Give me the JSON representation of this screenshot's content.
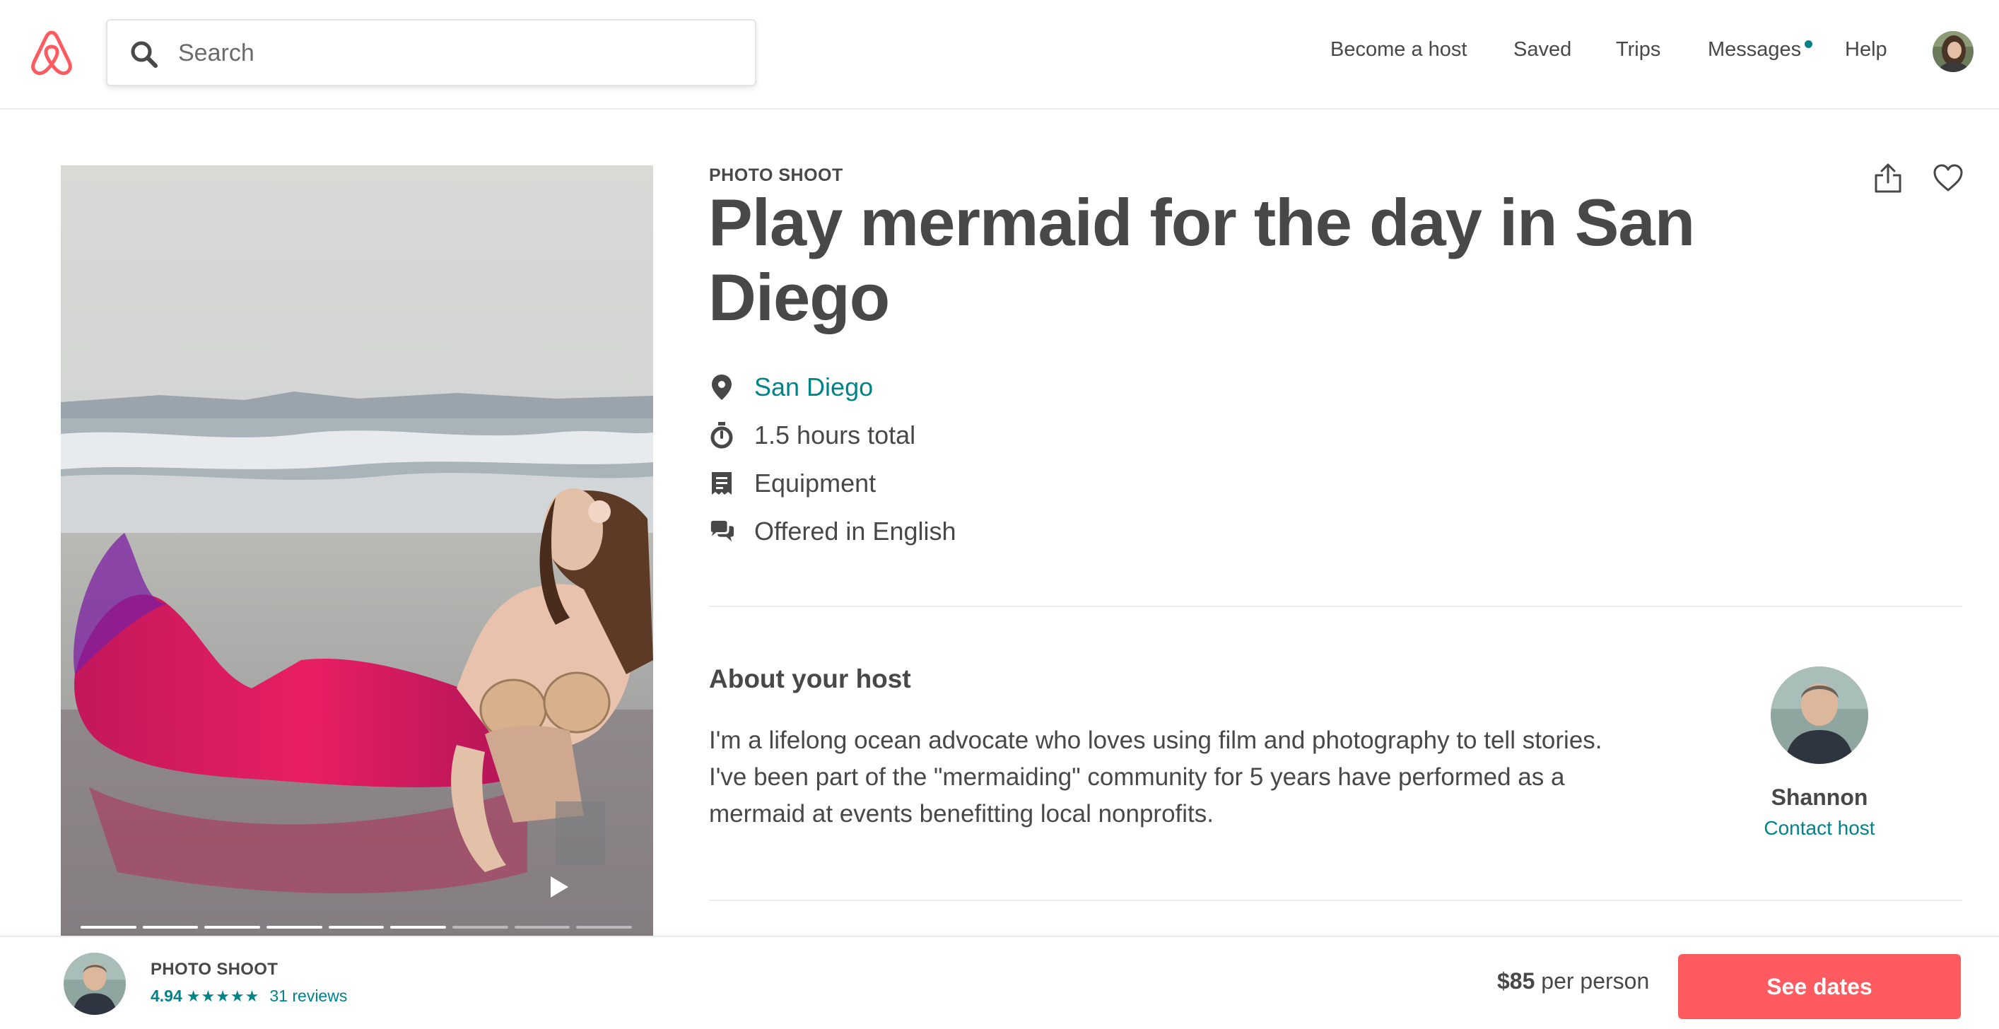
{
  "colors": {
    "brand": "#ff5a5f",
    "link": "#008489",
    "text": "#484848",
    "divider": "#ebebeb"
  },
  "header": {
    "logo_icon": "airbnb-belo-icon",
    "search": {
      "placeholder": "Search",
      "icon": "search-icon"
    },
    "nav": {
      "become_host": "Become a host",
      "saved": "Saved",
      "trips": "Trips",
      "messages": "Messages",
      "help": "Help"
    },
    "messages_unread_dot": true,
    "profile_icon": "user-avatar"
  },
  "media": {
    "play_icon": "play-icon",
    "slides_total": 9,
    "slides_viewed": 6
  },
  "listing": {
    "category": "PHOTO SHOOT",
    "title": "Play mermaid for the day in San Diego",
    "share_icon": "share-icon",
    "save_icon": "heart-icon",
    "details": [
      {
        "icon": "location-pin-icon",
        "text": "San Diego",
        "is_link": true
      },
      {
        "icon": "stopwatch-icon",
        "text": "1.5 hours total",
        "is_link": false
      },
      {
        "icon": "receipt-icon",
        "text": "Equipment",
        "is_link": false
      },
      {
        "icon": "chat-bubbles-icon",
        "text": "Offered in English",
        "is_link": false
      }
    ]
  },
  "host": {
    "heading": "About your host",
    "bio": "I'm a lifelong ocean advocate who loves using film and photography to tell stories. I've been part of the \"mermaiding\" community for 5 years have performed as a mermaid at events benefitting local nonprofits.",
    "name": "Shannon",
    "contact_label": "Contact host"
  },
  "footer_bar": {
    "category": "PHOTO SHOOT",
    "rating": "4.94",
    "stars": "★★★★★",
    "reviews": "31 reviews",
    "price": "$85",
    "price_unit": "per person",
    "cta": "See dates"
  }
}
